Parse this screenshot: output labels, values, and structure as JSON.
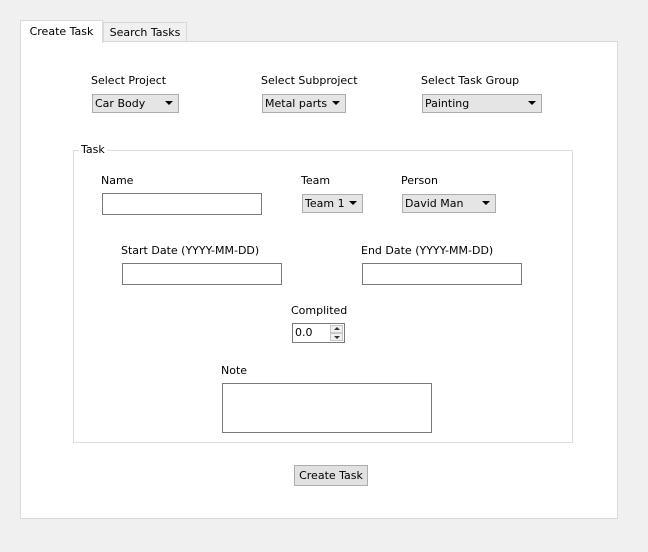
{
  "tabs": [
    {
      "label": "Create Task",
      "active": true
    },
    {
      "label": "Search Tasks",
      "active": false
    }
  ],
  "project": {
    "label": "Select Project",
    "value": "Car Body"
  },
  "subproject": {
    "label": "Select Subproject",
    "value": "Metal parts"
  },
  "task_group": {
    "label": "Select Task Group",
    "value": "Painting"
  },
  "task_group_box": {
    "title": "Task"
  },
  "name": {
    "label": "Name",
    "value": ""
  },
  "team": {
    "label": "Team",
    "value": "Team 1"
  },
  "person": {
    "label": "Person",
    "value": "David Man"
  },
  "start_date": {
    "label": "Start Date (YYYY-MM-DD)",
    "value": ""
  },
  "end_date": {
    "label": "End Date (YYYY-MM-DD)",
    "value": ""
  },
  "completed": {
    "label": "Complited",
    "value": "0.0"
  },
  "note": {
    "label": "Note",
    "value": ""
  },
  "create_button": {
    "label": "Create Task"
  },
  "icons": {
    "dropdown": "chevron-down-icon",
    "spin_up": "spin-up-icon",
    "spin_down": "spin-down-icon"
  }
}
